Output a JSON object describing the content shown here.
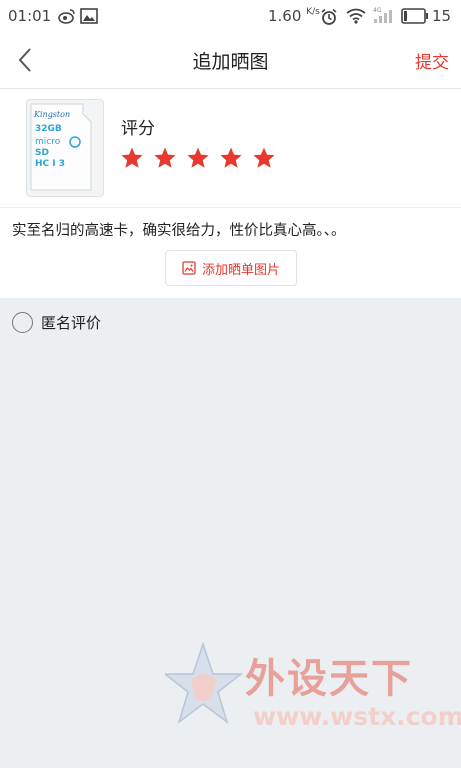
{
  "status_bar": {
    "time": "01:01",
    "network_speed": "1.60",
    "network_speed_unit": "K/s",
    "signal_label": "4G",
    "battery": "15"
  },
  "header": {
    "title": "追加晒图",
    "submit_label": "提交"
  },
  "product": {
    "image_label": "Kingston microSD 32GB card",
    "brand_text": "Kingston",
    "capacity_text": "32GB"
  },
  "rating": {
    "label": "评分",
    "stars_filled": 5,
    "stars_total": 5,
    "star_color": "#e8382f"
  },
  "review": {
    "text": "实至名归的高速卡，确实很给力，性价比真心高。、。"
  },
  "add_photo": {
    "label": "添加晒单图片"
  },
  "anonymous": {
    "label": "匿名评价",
    "checked": false
  },
  "watermark": {
    "text": "外设天下",
    "url": "www.wstx.com"
  },
  "colors": {
    "accent": "#e8382f",
    "background": "#eceff1"
  }
}
